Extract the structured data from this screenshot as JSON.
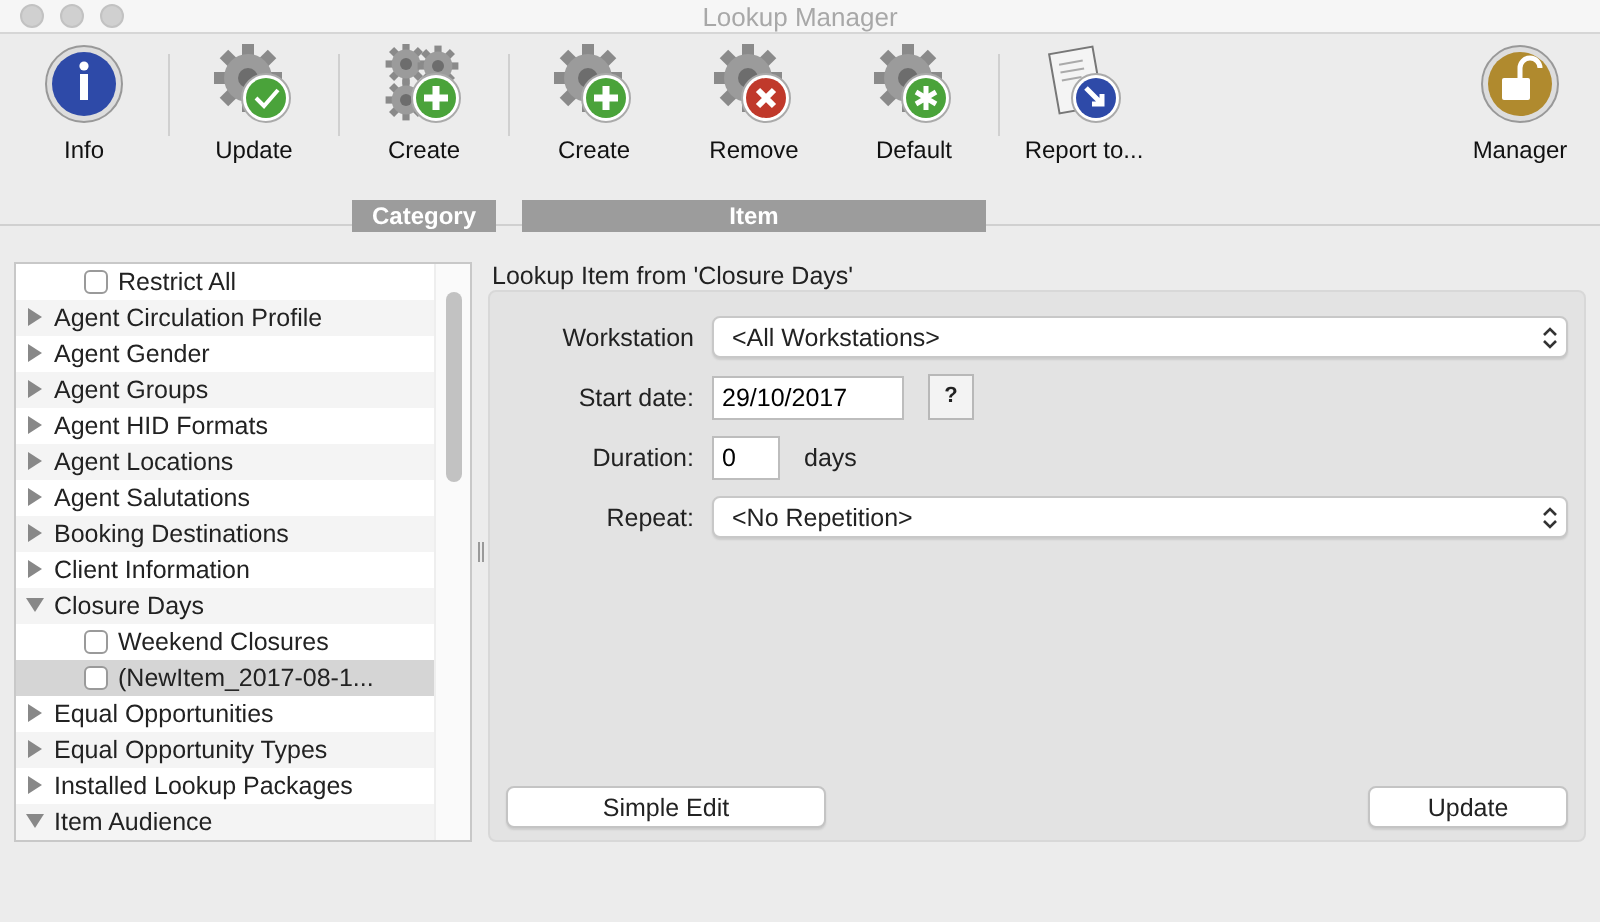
{
  "window": {
    "title": "Lookup Manager"
  },
  "toolbar": {
    "sections": [
      {
        "buttons": [
          {
            "kind": "info",
            "label": "Info"
          }
        ]
      },
      {
        "buttons": [
          {
            "kind": "update",
            "label": "Update"
          }
        ]
      },
      {
        "group": "Category",
        "buttons": [
          {
            "kind": "create",
            "label": "Create"
          }
        ]
      },
      {
        "group": "Item",
        "buttons": [
          {
            "kind": "add",
            "label": "Create"
          },
          {
            "kind": "remove",
            "label": "Remove"
          },
          {
            "kind": "default",
            "label": "Default"
          }
        ]
      },
      {
        "buttons": [
          {
            "kind": "report",
            "label": "Report to..."
          }
        ]
      },
      {
        "buttons": [
          {
            "kind": "manager",
            "label": "Manager"
          }
        ]
      }
    ]
  },
  "tree": [
    {
      "kind": "check",
      "label": "Restrict All",
      "checked": false,
      "selected": false
    },
    {
      "kind": "category",
      "label": "Agent Circulation Profile",
      "expanded": false
    },
    {
      "kind": "category",
      "label": "Agent Gender",
      "expanded": false
    },
    {
      "kind": "category",
      "label": "Agent Groups",
      "expanded": false
    },
    {
      "kind": "category",
      "label": "Agent HID Formats",
      "expanded": false
    },
    {
      "kind": "category",
      "label": "Agent Locations",
      "expanded": false
    },
    {
      "kind": "category",
      "label": "Agent Salutations",
      "expanded": false
    },
    {
      "kind": "category",
      "label": "Booking Destinations",
      "expanded": false
    },
    {
      "kind": "category",
      "label": "Client Information",
      "expanded": false
    },
    {
      "kind": "category",
      "label": "Closure Days",
      "expanded": true,
      "children": [
        {
          "kind": "check",
          "label": "Weekend Closures",
          "checked": false,
          "selected": false
        },
        {
          "kind": "check",
          "label": "(NewItem_2017-08-1...",
          "checked": false,
          "selected": true
        }
      ]
    },
    {
      "kind": "category",
      "label": "Equal Opportunities",
      "expanded": false
    },
    {
      "kind": "category",
      "label": "Equal Opportunity Types",
      "expanded": false
    },
    {
      "kind": "category",
      "label": "Installed Lookup Packages",
      "expanded": false
    },
    {
      "kind": "category",
      "label": "Item Audience",
      "expanded": true
    }
  ],
  "detail": {
    "title": "Lookup Item from 'Closure Days'",
    "workstation": {
      "label": "Workstation",
      "value": "<All Workstations>"
    },
    "start_date": {
      "label": "Start date:",
      "value": "29/10/2017",
      "help": "?"
    },
    "duration": {
      "label": "Duration:",
      "value": "0",
      "unit": "days"
    },
    "repeat": {
      "label": "Repeat:",
      "value": "<No Repetition>"
    },
    "buttons": [
      "Simple Edit",
      "Update"
    ]
  }
}
